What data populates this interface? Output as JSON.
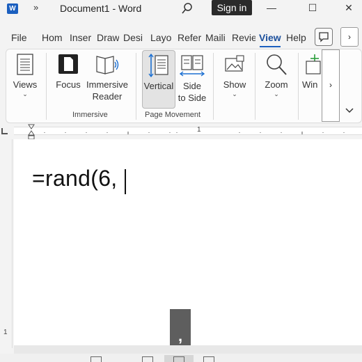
{
  "titlebar": {
    "logo": "W",
    "more": "»",
    "title": "Document1  -  Word",
    "signin": "Sign in",
    "minimize": "—",
    "maximize": "☐",
    "close": "✕"
  },
  "tabs": [
    {
      "label": "File"
    },
    {
      "label": "Hom"
    },
    {
      "label": "Inser"
    },
    {
      "label": "Draw"
    },
    {
      "label": "Desi"
    },
    {
      "label": "Layo"
    },
    {
      "label": "Refer"
    },
    {
      "label": "Maili"
    },
    {
      "label": "Revie"
    },
    {
      "label": "View"
    },
    {
      "label": "Help"
    }
  ],
  "tabs_more": "›",
  "ribbon": {
    "views": "Views",
    "focus": "Focus",
    "immersive_reader_1": "Immersive",
    "immersive_reader_2": "Reader",
    "vertical": "Vertical",
    "side_1": "Side",
    "side_2": "to Side",
    "show": "Show",
    "zoom": "Zoom",
    "window": "Win",
    "group_immersive": "Immersive",
    "group_page_movement": "Page Movement",
    "more": "›",
    "collapse": "⌄",
    "chev": "⌄"
  },
  "ruler": {
    "h_number": "1",
    "v_number": "1"
  },
  "document": {
    "text": "=rand(6,"
  },
  "autocomplete": {
    "text": ","
  }
}
